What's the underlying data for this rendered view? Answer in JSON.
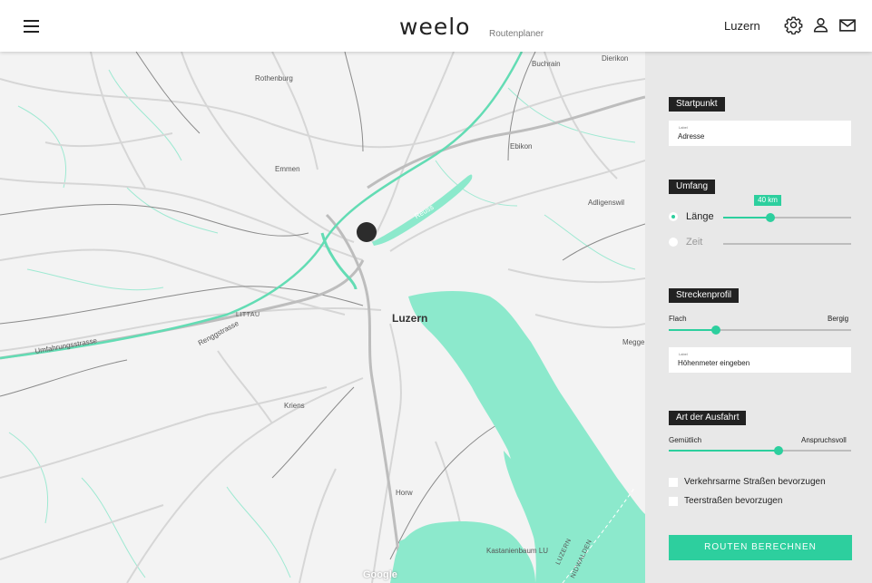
{
  "header": {
    "menu_icon": "hamburger-menu-icon",
    "logo": "weelo",
    "subtitle": "Routenplaner",
    "city": "Luzern",
    "icons": [
      "gear-icon",
      "user-icon",
      "mail-icon"
    ]
  },
  "map": {
    "places": {
      "rothenburg": "Rothenburg",
      "buchrain": "Buchrain",
      "dierikon": "Dierikon",
      "emmen": "Emmen",
      "ebikon": "Ebikon",
      "adligenswil": "Adligenswil",
      "littau": "LITTAU",
      "luzern": "Luzern",
      "umfahrungsstrasse": "Umfahrungsstrasse",
      "renggstrasse": "Renggstrasse",
      "kriens": "Kriens",
      "horw": "Horw",
      "kastanienbaum": "Kastanienbaum LU",
      "megger": "Megge",
      "reuss": "Reuss",
      "luzern_nidwalden_1": "LUZERN",
      "luzern_nidwalden_2": "NIDWALDEN"
    },
    "attribution": "Google",
    "colors": {
      "water": "#8ce9cc",
      "road": "#cfcfcf",
      "road_dark": "#6f6f6f",
      "background": "#f3f3f3"
    }
  },
  "sidebar": {
    "startpunkt": {
      "title": "Startpunkt",
      "field_label": "Label",
      "field_value": "Adresse"
    },
    "umfang": {
      "title": "Umfang",
      "option_length": "Länge",
      "option_time": "Zeit",
      "selected": "Länge",
      "length_value": "40 km",
      "length_level": 0.37
    },
    "streckenprofil": {
      "title": "Streckenprofil",
      "left": "Flach",
      "right": "Bergig",
      "level": 0.26,
      "field_label": "Label",
      "field_value": "Höhenmeter eingeben"
    },
    "ausfahrt": {
      "title": "Art der Ausfahrt",
      "left": "Gemütlich",
      "right": "Anspruchsvoll",
      "level": 0.6
    },
    "checks": {
      "verkehrsarm": "Verkehrsarme Straßen bevorzugen",
      "teer": "Teerstraßen bevorzugen"
    },
    "cta": "ROUTEN BERECHNEN"
  },
  "colors": {
    "accent": "#2dcf9e",
    "tag_bg": "#222222",
    "panel_bg": "#e8e8e8"
  }
}
